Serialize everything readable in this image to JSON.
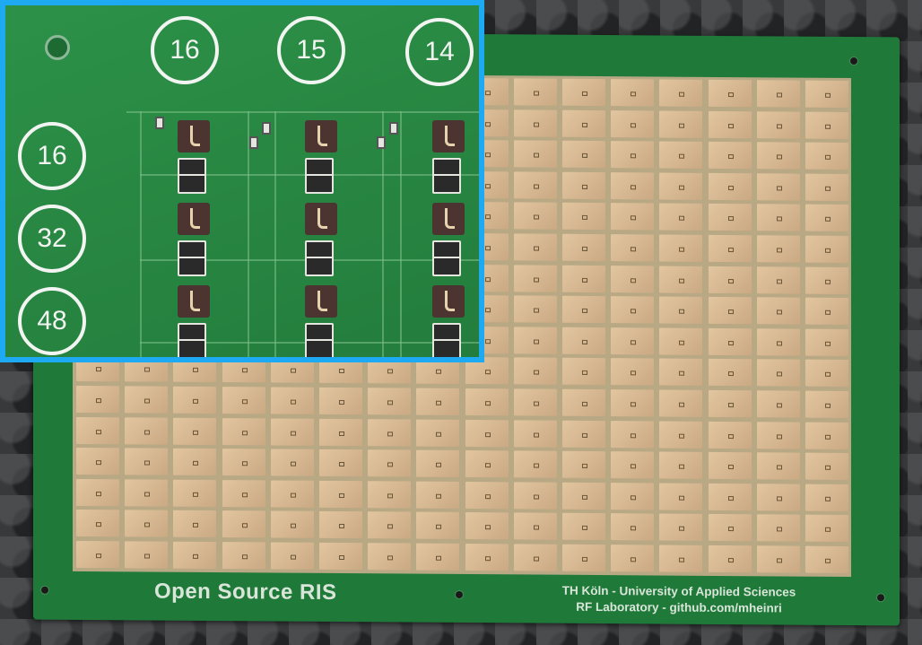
{
  "board": {
    "title": "Open Source RIS",
    "credits_line1": "TH Köln - University of Applied Sciences",
    "credits_line2": "RF Laboratory - github.com/mheinri",
    "colors": {
      "pcb": "#1f7a3a",
      "copper": "#d8bb94",
      "inset_border": "#1ea9f3"
    }
  },
  "inset": {
    "top_labels": [
      "16",
      "15",
      "14"
    ],
    "left_labels": [
      "16",
      "32",
      "48"
    ]
  }
}
